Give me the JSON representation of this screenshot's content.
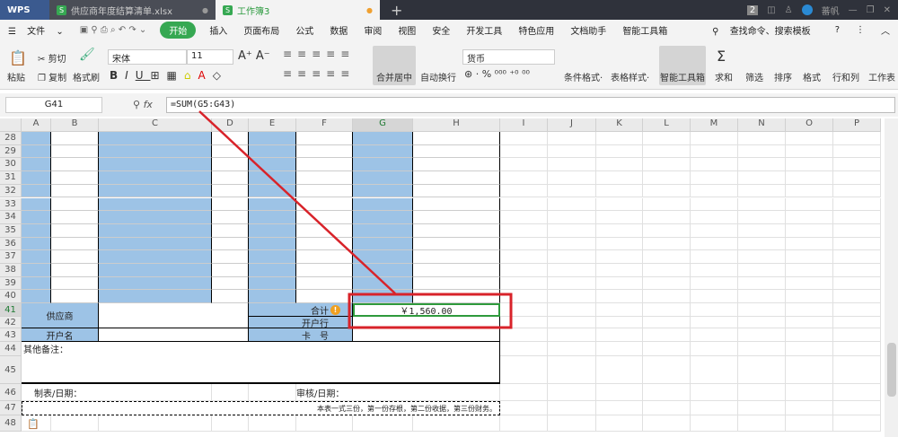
{
  "tabbar": {
    "app": "WPS",
    "tabs": [
      {
        "label": "供应商年度结算清单.xlsx"
      },
      {
        "label": "工作簿3"
      }
    ],
    "badge": "2",
    "user": "蕃帆"
  },
  "menu": {
    "file": "文件",
    "items": [
      "开始",
      "插入",
      "页面布局",
      "公式",
      "数据",
      "审阅",
      "视图",
      "安全",
      "开发工具",
      "特色应用",
      "文档助手",
      "智能工具箱"
    ],
    "search": "查找命令、搜索模板"
  },
  "ribbon": {
    "paste": "粘贴",
    "cut": "剪切",
    "copy": "复制",
    "format_painter": "格式刷",
    "font": "宋体",
    "size": "11",
    "merge": "合并居中",
    "wrap": "自动换行",
    "number_format": "货币",
    "cond_format": "条件格式",
    "table_style": "表格样式",
    "smart_toolbox": "智能工具箱",
    "sum": "求和",
    "filter": "筛选",
    "sort": "排序",
    "format": "格式",
    "rowcol": "行和列",
    "sheet": "工作表"
  },
  "formula_bar": {
    "name_box": "G41",
    "fx": "fx",
    "formula": "=SUM(G5:G43)"
  },
  "columns": [
    "A",
    "B",
    "C",
    "D",
    "E",
    "F",
    "G",
    "H",
    "I",
    "J",
    "K",
    "L",
    "M",
    "N",
    "O",
    "P"
  ],
  "rows": [
    "28",
    "29",
    "30",
    "31",
    "32",
    "33",
    "34",
    "35",
    "36",
    "37",
    "38",
    "39",
    "40",
    "41",
    "42",
    "43",
    "44",
    "45",
    "46",
    "47",
    "48"
  ],
  "cells": {
    "supplier": "供应商",
    "total": "合计",
    "total_value": "￥1,560.00",
    "bank": "开户行",
    "account_name": "开户名",
    "card_no": "卡　号",
    "remarks": "其他备注：",
    "maker_date": "制表/日期：",
    "reviewer_date": "审核/日期：",
    "footnote": "本表一式三份，第一份存根，第二份收据，第三份财务。"
  },
  "colors": {
    "accent": "#36a852",
    "fill_blue": "#9dc3e6",
    "highlight_red": "#e02020",
    "selection_green": "#2e9a3c"
  }
}
